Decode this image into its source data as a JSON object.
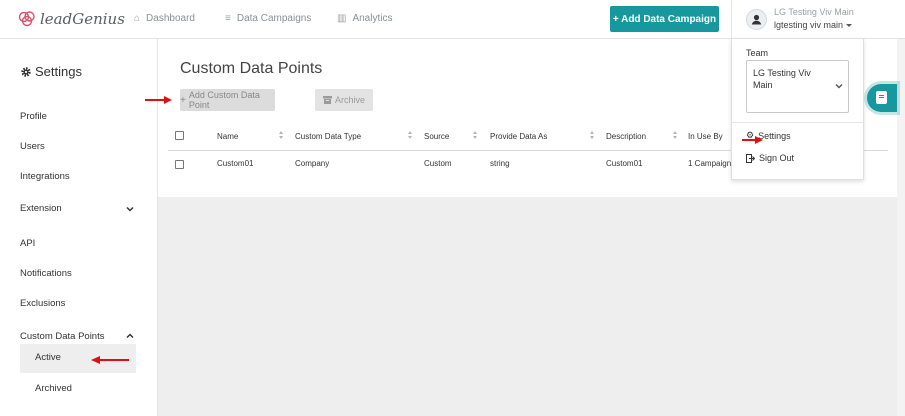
{
  "app": {
    "logo_text": "leadGenius"
  },
  "navbar": {
    "items": [
      {
        "label": "Dashboard",
        "icon": "home-icon"
      },
      {
        "label": "Data Campaigns",
        "icon": "database-icon"
      },
      {
        "label": "Analytics",
        "icon": "bar-chart-icon"
      }
    ],
    "add_campaign_label": "+ Add Data Campaign",
    "user": {
      "name": "LG Testing Viv Main",
      "team": "lgtesting viv main"
    }
  },
  "sidebar": {
    "title": "Settings",
    "items": [
      {
        "label": "Profile"
      },
      {
        "label": "Users"
      },
      {
        "label": "Integrations"
      },
      {
        "label": "Extension"
      },
      {
        "label": "API"
      },
      {
        "label": "Notifications"
      },
      {
        "label": "Exclusions"
      },
      {
        "label": "Custom Data Points"
      }
    ],
    "subitems": [
      {
        "label": "Active",
        "selected": true
      },
      {
        "label": "Archived",
        "selected": false
      }
    ]
  },
  "main": {
    "title": "Custom Data Points",
    "add_button": "Add Custom Data Point",
    "archive_button": "Archive",
    "columns": [
      "Name",
      "Custom Data Type",
      "Source",
      "Provide Data As",
      "Description",
      "In Use By"
    ],
    "rows": [
      [
        "Custom01",
        "Company",
        "Custom",
        "string",
        "Custom01",
        "1 Campaign"
      ]
    ]
  },
  "dropdown": {
    "team_label": "Team",
    "team_selected": "LG Testing Viv Main",
    "settings_label": "Settings",
    "signout_label": "Sign Out"
  },
  "colors": {
    "accent": "#17989e",
    "annotation_arrow": "#e01010",
    "page_gray": "#eeeeef"
  }
}
